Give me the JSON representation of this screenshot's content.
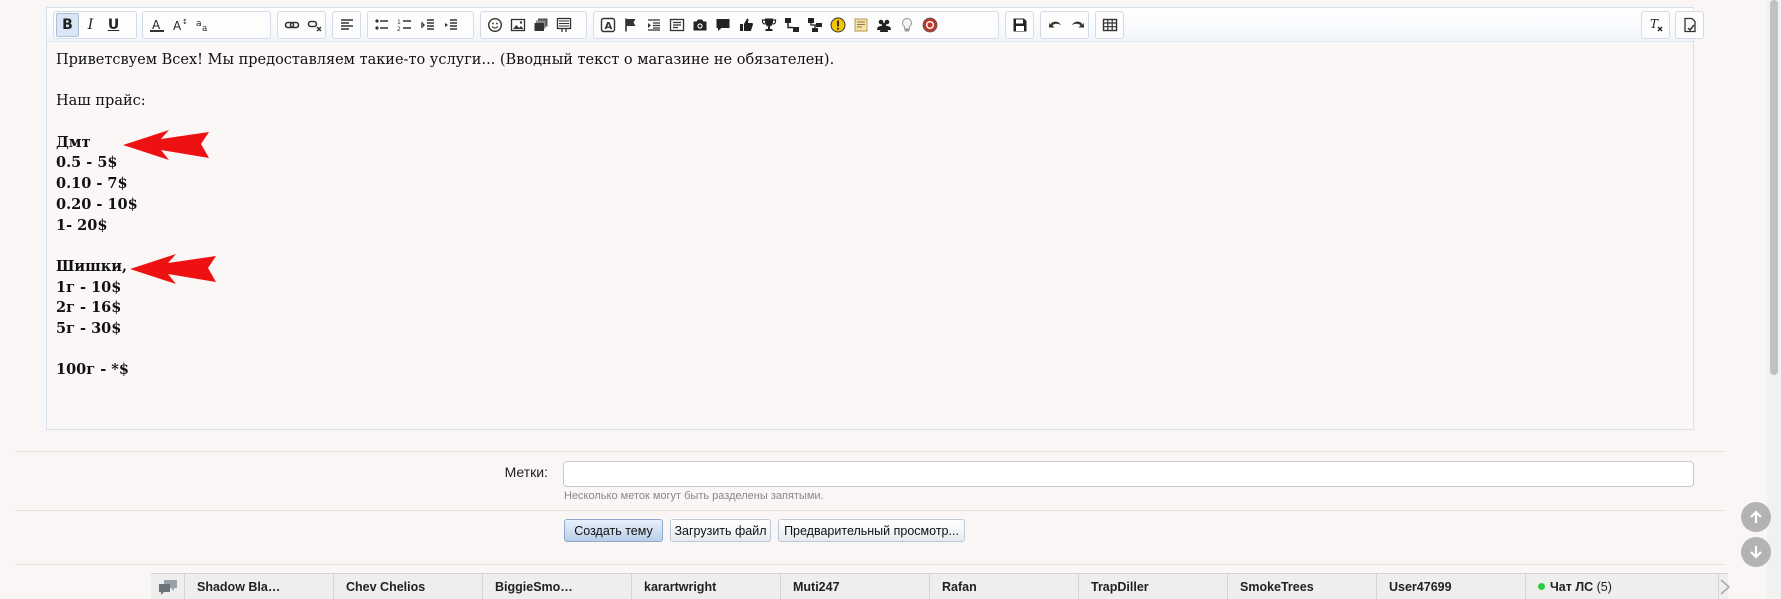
{
  "editor": {
    "content_lines": [
      {
        "text": "Приветсвуем Всех! Мы предоставляем такие-то услуги... (Вводный текст о магазине не обязателен).",
        "bold": false
      },
      {
        "text": "",
        "bold": false
      },
      {
        "text": "Наш прайс:",
        "bold": false
      },
      {
        "text": "",
        "bold": false
      },
      {
        "text": "Дмт",
        "bold": true
      },
      {
        "text": "0.5 - 5$",
        "bold": true
      },
      {
        "text": "0.10 - 7$",
        "bold": true
      },
      {
        "text": "0.20 - 10$",
        "bold": true
      },
      {
        "text": "1- 20$",
        "bold": true
      },
      {
        "text": "",
        "bold": false
      },
      {
        "text": "Шишки,",
        "bold": true
      },
      {
        "text": "1г - 10$",
        "bold": true
      },
      {
        "text": "2г - 16$",
        "bold": true
      },
      {
        "text": "5г - 30$",
        "bold": true
      },
      {
        "text": "",
        "bold": false
      },
      {
        "text": "100г - *$",
        "bold": true
      }
    ]
  },
  "form": {
    "tags_label": "Метки:",
    "tags_value": "",
    "tags_hint": "Несколько меток могут быть разделены запятыми.",
    "create_button": "Создать тему",
    "upload_button": "Загрузить файл",
    "preview_button": "Предварительный просмотр..."
  },
  "chat": {
    "tabs": [
      "Shadow Bla…",
      "Chev Chelios",
      "BiggieSmo…",
      "karartwright",
      "Muti247",
      "Rafan",
      "TrapDiller",
      "SmokeTrees",
      "User47699"
    ],
    "pm_label": "Чат ЛС",
    "pm_count": "(5)"
  },
  "colors": {
    "accent": "#2ecc40",
    "arrow": "#ee1111"
  }
}
